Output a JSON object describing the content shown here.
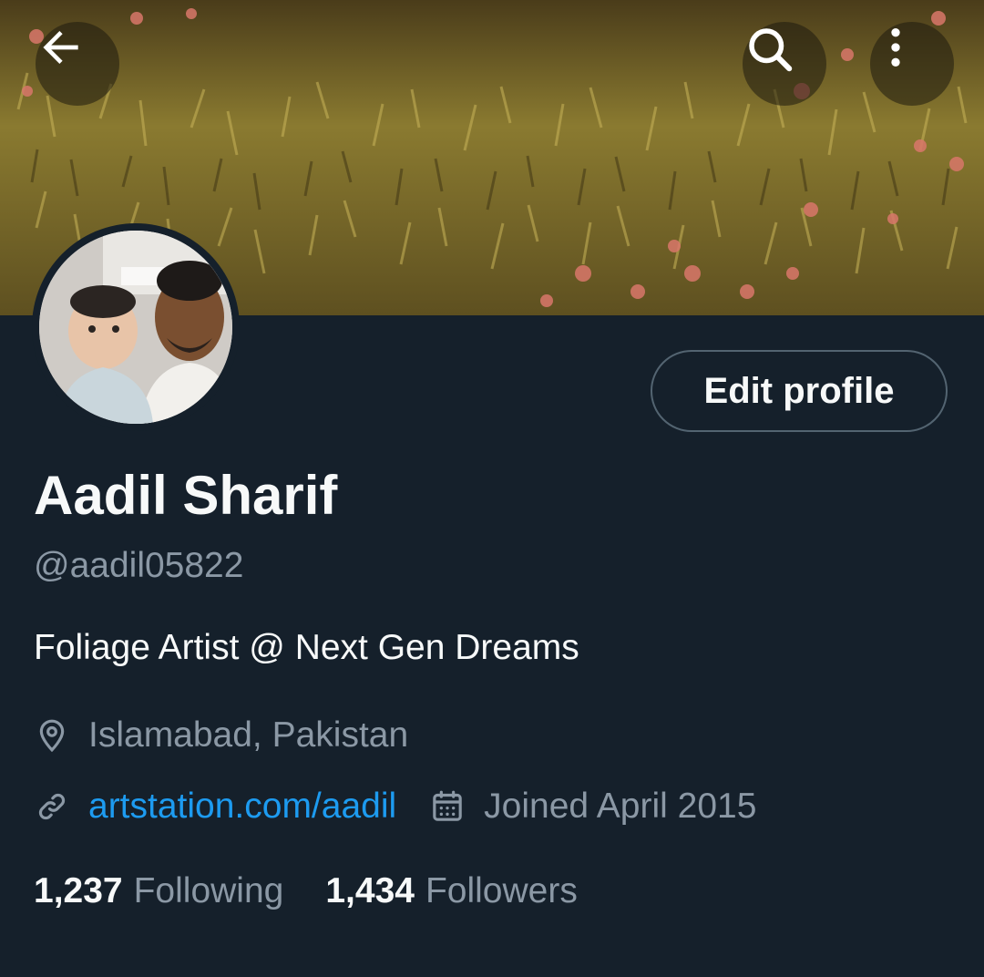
{
  "profile": {
    "name": "Aadil Sharif",
    "handle": "@aadil05822",
    "bio": "Foliage Artist @ Next Gen Dreams",
    "location": "Islamabad, Pakistan",
    "website": "artstation.com/aadil",
    "joined": "Joined April 2015"
  },
  "actions": {
    "edit_profile": "Edit profile"
  },
  "stats": {
    "following_count": "1,237",
    "following_label": "Following",
    "followers_count": "1,434",
    "followers_label": "Followers"
  },
  "icons": {
    "back": "arrow-left-icon",
    "search": "search-icon",
    "more": "more-vertical-icon",
    "location": "location-pin-icon",
    "link": "link-icon",
    "calendar": "calendar-icon"
  },
  "colors": {
    "background": "#15202b",
    "text_primary": "#f7f9f9",
    "text_secondary": "#8b98a5",
    "link": "#1d9bf0",
    "border": "#536471"
  }
}
